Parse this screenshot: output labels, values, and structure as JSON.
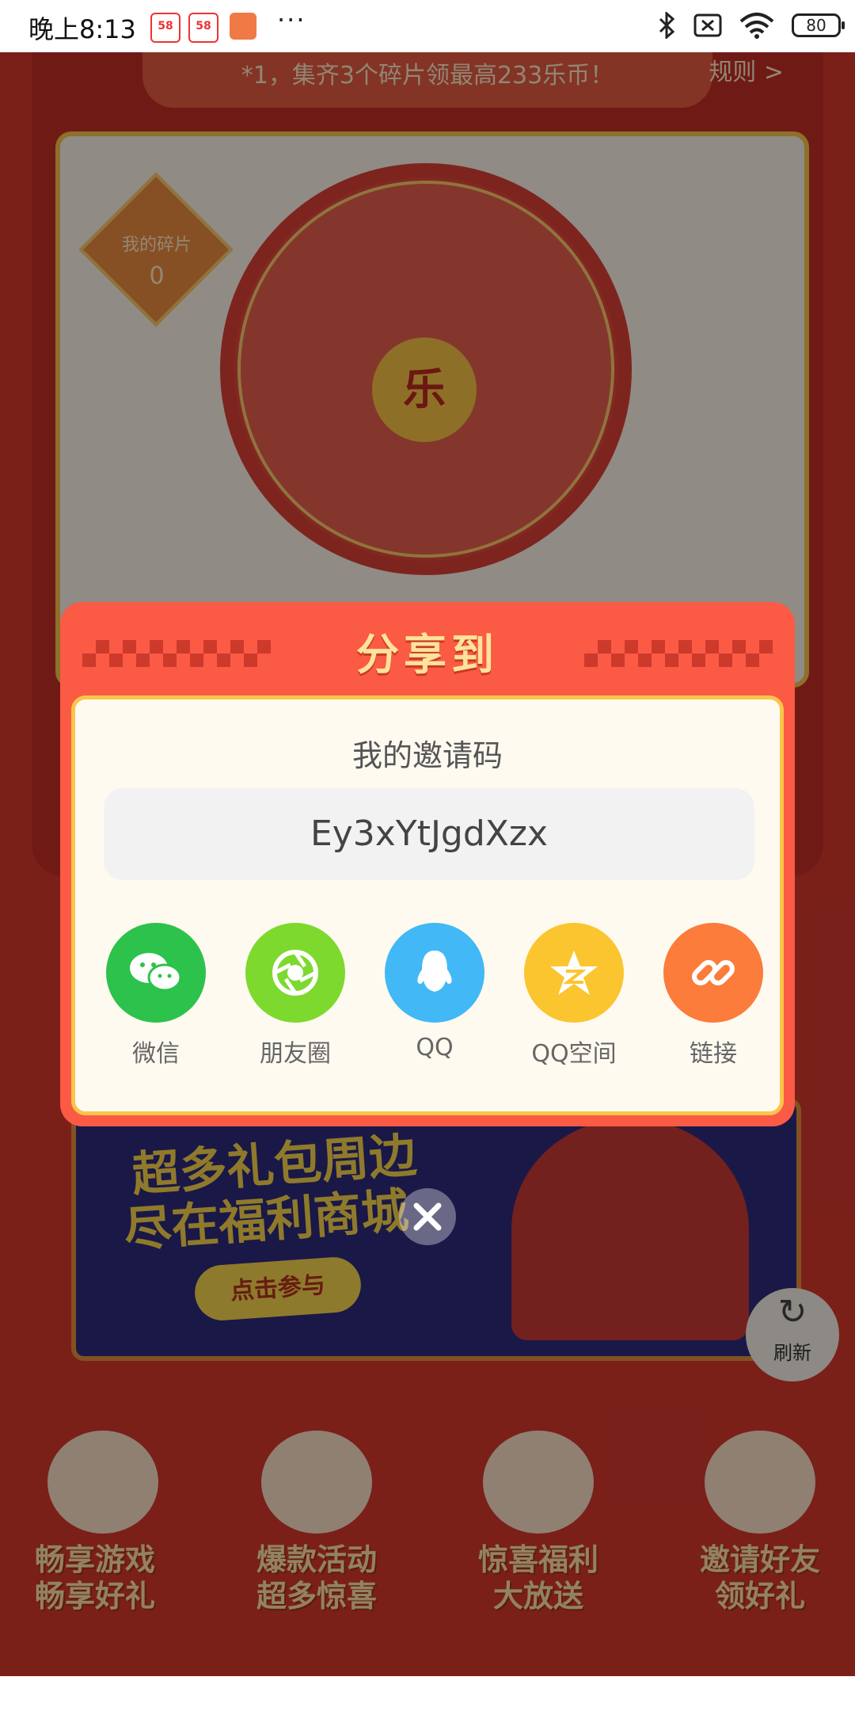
{
  "status_bar": {
    "time": "晚上8:13",
    "app_badge_1": "58",
    "app_badge_2": "58",
    "more": "···",
    "battery": "80"
  },
  "background": {
    "banner_text": "*1，集齐3个碎片领最高233乐币！",
    "rule_link": "规则 >",
    "fragment_label": "我的碎片",
    "fragment_count": "0",
    "wheel_center": "乐",
    "shop_line1": "超多礼包周边",
    "shop_line2": "尽在福利商城",
    "shop_button": "点击参与",
    "refresh_label": "刷新",
    "features": [
      {
        "line1": "畅享游戏",
        "line2": "畅享好礼"
      },
      {
        "line1": "爆款活动",
        "line2": "超多惊喜"
      },
      {
        "line1": "惊喜福利",
        "line2": "大放送"
      },
      {
        "line1": "邀请好友",
        "line2": "领好礼"
      }
    ]
  },
  "share_dialog": {
    "title": "分享到",
    "invite_label": "我的邀请码",
    "invite_code": "Ey3xYtJgdXzx",
    "targets": [
      {
        "label": "微信",
        "icon": "wechat-icon",
        "color": "#2dc24b"
      },
      {
        "label": "朋友圈",
        "icon": "moments-icon",
        "color": "#7ed92f"
      },
      {
        "label": "QQ",
        "icon": "qq-icon",
        "color": "#42b8f6"
      },
      {
        "label": "QQ空间",
        "icon": "qzone-icon",
        "color": "#fbc530"
      },
      {
        "label": "链接",
        "icon": "link-icon",
        "color": "#fb7c3b"
      }
    ]
  }
}
